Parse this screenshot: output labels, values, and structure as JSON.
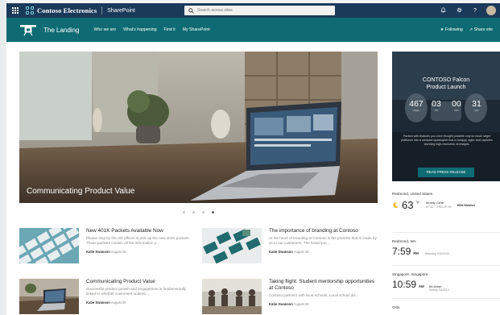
{
  "suite": {
    "brand": "Contoso Electronics",
    "app": "SharePoint",
    "search_placeholder": "Search across sites"
  },
  "site": {
    "title": "The Landing",
    "nav": [
      "Who we are",
      "What's happening",
      "Find it",
      "My SharePoint"
    ],
    "following": "Following",
    "share": "Share site"
  },
  "hero": {
    "caption": "Communicating Product Value",
    "slides": 4,
    "active_slide": 4
  },
  "news": [
    {
      "title": "New 401K Packets Available Now",
      "body": "Please stop by the HR offices to pick up the new 401K packets. These packets contain all the information y...",
      "author": "Katie Swanson",
      "date": "August 28"
    },
    {
      "title": "The importance of branding at Contoso",
      "body": "At the heart of branding at Contoso is the promise that is made by us to our customers. The brand pro...",
      "author": "Katie Swanson",
      "date": "August 28"
    },
    {
      "title": "Communicating Product Value",
      "body": "Successful product growth and engagement is fundamentally linked to whether customers underst...",
      "author": "Katie Swanson",
      "date": "August 28"
    },
    {
      "title": "Taking flight: Student mentorship opportunities at Contoso",
      "body": "Contoso partners with local schools. Local school dis...",
      "author": "Katie Swanson",
      "date": "August 28"
    }
  ],
  "promo": {
    "title_line1": "CONTOSO Falcon",
    "title_line2": "Product Launch",
    "countdown": [
      {
        "value": "467",
        "label": "days"
      },
      {
        "value": "03",
        "label": "hrs"
      },
      {
        "value": "00",
        "label": "min"
      },
      {
        "value": "31",
        "label": "sec"
      }
    ],
    "description": "Packed with features you once thought possible only on much larger platforms into a compact quadcopter that is snappy, agile, and captures stunning high-resolution 4k images.",
    "button": "READ PRESS RELEASE"
  },
  "weather": {
    "location": "Redmond, United States",
    "temp": "63",
    "unit": "°F",
    "condition": "Mostly Clear",
    "detail_1": "57°/62°",
    "detail_2": "PRECIP 0%",
    "source": "MSN Weather"
  },
  "clocks": [
    {
      "location": "Redmond, WA",
      "time": "7:59",
      "ampm": "PM",
      "date": "Saturday, 8/31/2019",
      "cond": "",
      "cond_sub": ""
    },
    {
      "location": "Singapore, Singapore",
      "time": "10:59",
      "ampm": "AM",
      "date": "",
      "cond": "5th ahead",
      "cond_sub": "Sunday, 9/1/2019"
    },
    {
      "location": "Oslo",
      "time": "",
      "ampm": "",
      "date": "",
      "cond": "",
      "cond_sub": ""
    }
  ],
  "colors": {
    "suite_bar": "#1b3a5a",
    "site_bar": "#0f6b73",
    "promo_bg": "#1d2a36"
  }
}
